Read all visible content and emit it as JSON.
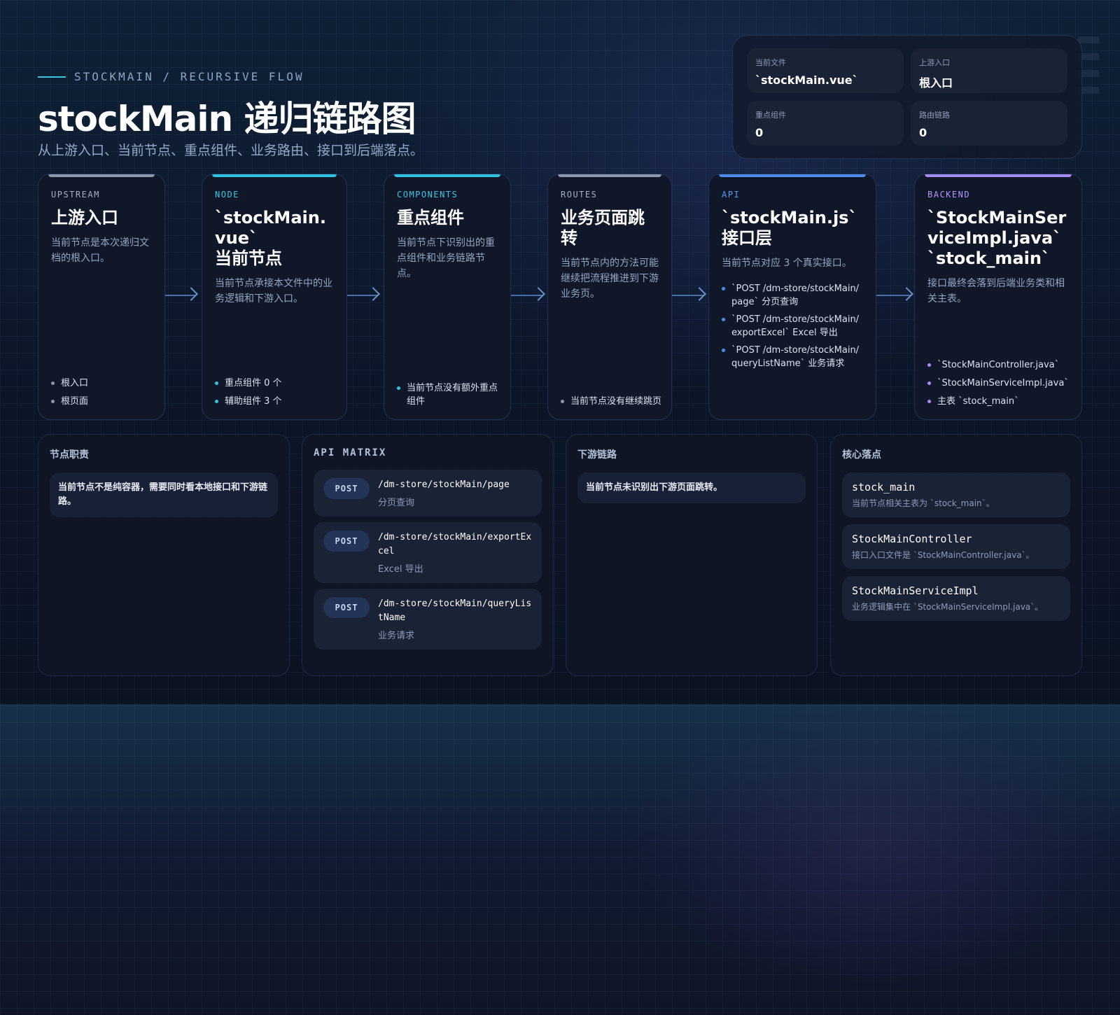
{
  "header": {
    "eyebrow": "STOCKMAIN / RECURSIVE FLOW",
    "title": "stockMain 递归链路图",
    "subtitle": "从上游入口、当前节点、重点组件、业务路由、接口到后端落点。"
  },
  "stats": [
    {
      "label": "当前文件",
      "value": "`stockMain.vue`"
    },
    {
      "label": "上游入口",
      "value": "根入口"
    },
    {
      "label": "重点组件",
      "value": "0"
    },
    {
      "label": "路由链路",
      "value": "0"
    }
  ],
  "flow": [
    {
      "kicker": "UPSTREAM",
      "title": "上游入口",
      "desc": "当前节点是本次递归文档的根入口。",
      "bullets": [
        "根入口",
        "根页面"
      ]
    },
    {
      "kicker": "NODE",
      "title": "`stockMain.vue`\n当前节点",
      "desc": "当前节点承接本文件中的业务逻辑和下游入口。",
      "bullets": [
        "重点组件 0 个",
        "辅助组件 3 个"
      ]
    },
    {
      "kicker": "COMPONENTS",
      "title": "重点组件",
      "desc": "当前节点下识别出的重点组件和业务链路节点。",
      "bullets": [
        "当前节点没有额外重点组件"
      ]
    },
    {
      "kicker": "ROUTES",
      "title": "业务页面跳转",
      "desc": "当前节点内的方法可能继续把流程推进到下游业务页。",
      "bullets": [
        "当前节点没有继续跳页"
      ]
    },
    {
      "kicker": "API",
      "title": "`stockMain.js`\n接口层",
      "desc": "当前节点对应 3 个真实接口。",
      "bullets": [
        "`POST /dm-store/stockMain/page` 分页查询",
        "`POST /dm-store/stockMain/exportExcel` Excel 导出",
        "`POST /dm-store/stockMain/queryListName` 业务请求"
      ]
    },
    {
      "kicker": "BACKEND",
      "title": "`StockMainServiceImpl.java`\n`stock_main`",
      "desc": "接口最终会落到后端业务类和相关主表。",
      "bullets": [
        "`StockMainController.java`",
        "`StockMainServiceImpl.java`",
        "主表 `stock_main`"
      ]
    }
  ],
  "panels": {
    "duty": {
      "title": "节点职责",
      "note": "当前节点不是纯容器，需要同时看本地接口和下游链路。"
    },
    "api": {
      "title": "API MATRIX",
      "rows": [
        {
          "method": "POST",
          "path": "/dm-store/stockMain/page",
          "desc": "分页查询"
        },
        {
          "method": "POST",
          "path": "/dm-store/stockMain/exportExcel",
          "desc": "Excel 导出"
        },
        {
          "method": "POST",
          "path": "/dm-store/stockMain/queryListName",
          "desc": "业务请求"
        }
      ]
    },
    "downstream": {
      "title": "下游链路",
      "note": "当前节点未识别出下游页面跳转。"
    },
    "core": {
      "title": "核心落点",
      "rows": [
        {
          "name": "stock_main",
          "desc": "当前节点相关主表为 `stock_main`。"
        },
        {
          "name": "StockMainController",
          "desc": "接口入口文件是 `StockMainController.java`。"
        },
        {
          "name": "StockMainServiceImpl",
          "desc": "业务逻辑集中在 `StockMainServiceImpl.java`。"
        }
      ]
    }
  },
  "colors": {
    "cyan": "#2fc4e4",
    "blue": "#4a8ff0",
    "purple": "#a78bfa",
    "grey": "#8d97ab"
  }
}
